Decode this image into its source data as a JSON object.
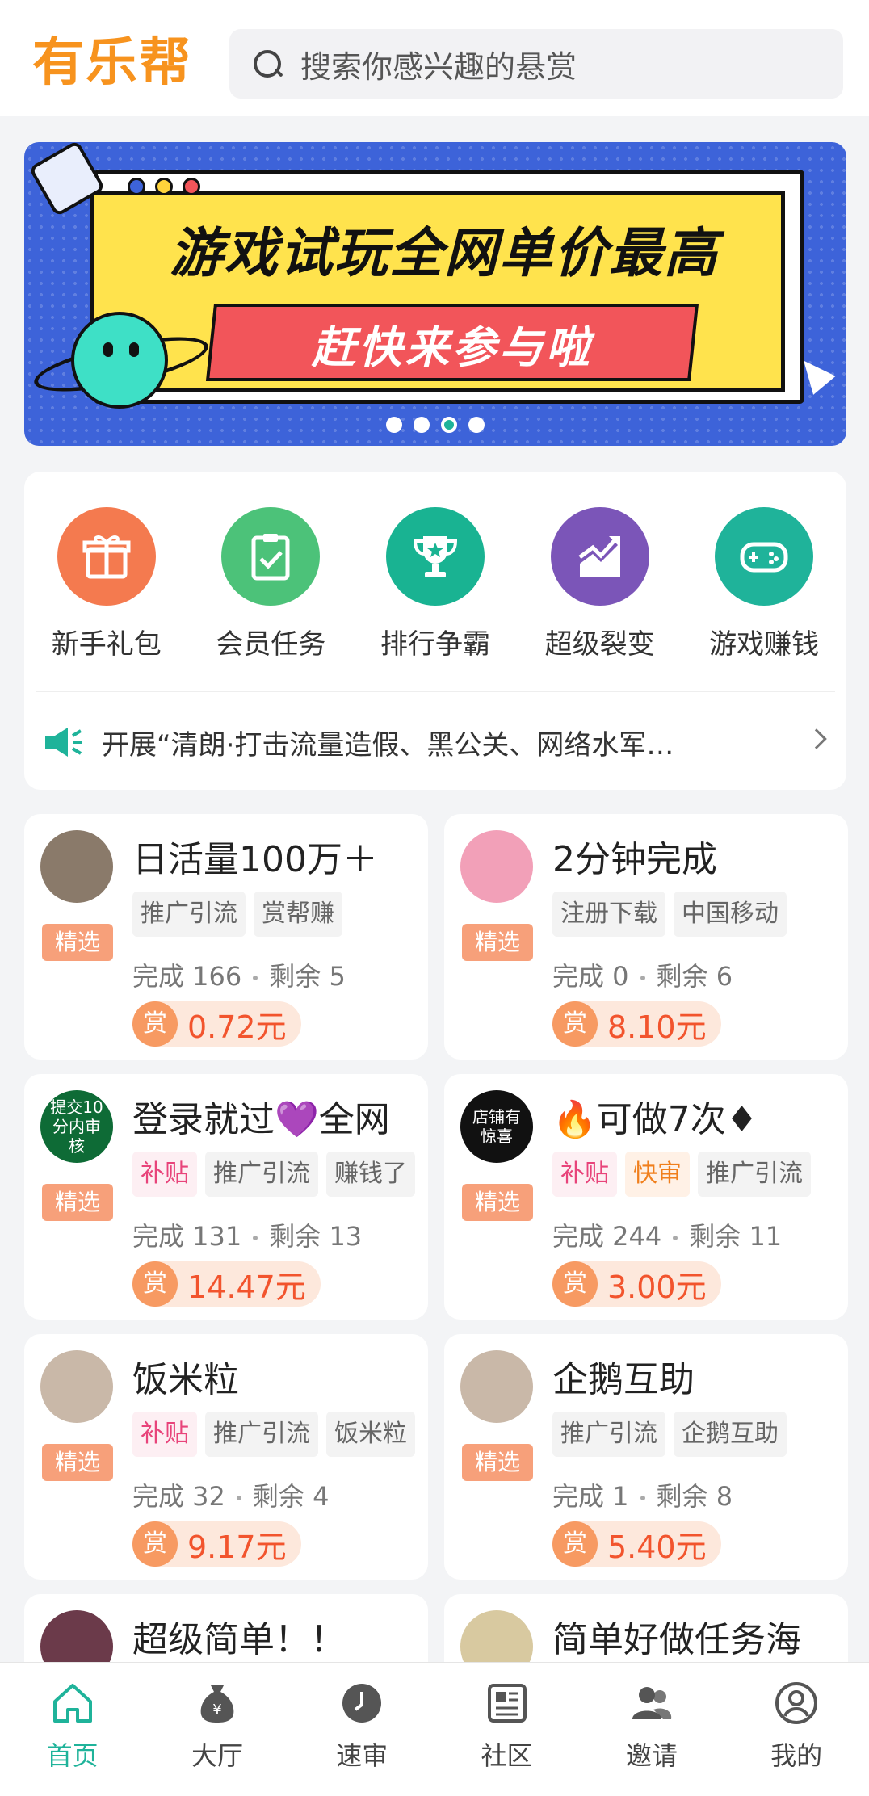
{
  "header": {
    "app_title": "有乐帮",
    "search_placeholder": "搜索你感兴趣的悬赏"
  },
  "banner": {
    "headline": "游戏试玩全网单价最高",
    "subline": "赶快来参与啦",
    "slides_count": 4,
    "active_slide": 3
  },
  "quick_menu": [
    {
      "label": "新手礼包",
      "icon": "gift-icon",
      "color": "#f47a4f"
    },
    {
      "label": "会员任务",
      "icon": "clipboard-check-icon",
      "color": "#4cc279"
    },
    {
      "label": "排行争霸",
      "icon": "trophy-icon",
      "color": "#19b392"
    },
    {
      "label": "超级裂变",
      "icon": "trend-chart-icon",
      "color": "#7b55b8"
    },
    {
      "label": "游戏赚钱",
      "icon": "gamepad-icon",
      "color": "#1fb39a"
    }
  ],
  "notice": {
    "icon": "megaphone-icon",
    "text": "开展“清朗·打击流量造假、黑公关、网络水军…"
  },
  "tasks": [
    {
      "title": "日活量100万＋",
      "badge": "精选",
      "tags": [
        {
          "text": "推广引流",
          "kind": "normal"
        },
        {
          "text": "赏帮赚",
          "kind": "normal"
        }
      ],
      "completed_label": "完成 166",
      "remaining_label": "剩余 5",
      "reward_icon": "赏",
      "reward": "0.72元",
      "avatar_color": "#8a7a6a"
    },
    {
      "title": "2分钟完成",
      "badge": "精选",
      "tags": [
        {
          "text": "注册下载",
          "kind": "normal"
        },
        {
          "text": "中国移动",
          "kind": "normal"
        }
      ],
      "completed_label": "完成 0",
      "remaining_label": "剩余 6",
      "reward_icon": "赏",
      "reward": "8.10元",
      "avatar_color": "#f2a0b8"
    },
    {
      "title": "登录就过💜全网",
      "badge": "精选",
      "tags": [
        {
          "text": "补贴",
          "kind": "sub"
        },
        {
          "text": "推广引流",
          "kind": "normal"
        },
        {
          "text": "赚钱了",
          "kind": "normal"
        }
      ],
      "completed_label": "完成 131",
      "remaining_label": "剩余 13",
      "reward_icon": "赏",
      "reward": "14.47元",
      "avatar_color": "#0e6b36",
      "avatar_text": "提交10分内审核"
    },
    {
      "title": "🔥可做7次♦",
      "badge": "精选",
      "tags": [
        {
          "text": "补贴",
          "kind": "sub"
        },
        {
          "text": "快审",
          "kind": "fast"
        },
        {
          "text": "推广引流",
          "kind": "normal"
        }
      ],
      "completed_label": "完成 244",
      "remaining_label": "剩余 11",
      "reward_icon": "赏",
      "reward": "3.00元",
      "avatar_color": "#111111",
      "avatar_text": "店铺有惊喜"
    },
    {
      "title": "饭米粒",
      "badge": "精选",
      "tags": [
        {
          "text": "补贴",
          "kind": "sub"
        },
        {
          "text": "推广引流",
          "kind": "normal"
        },
        {
          "text": "饭米粒",
          "kind": "normal"
        }
      ],
      "completed_label": "完成 32",
      "remaining_label": "剩余 4",
      "reward_icon": "赏",
      "reward": "9.17元",
      "avatar_color": "#c9b8a8"
    },
    {
      "title": "企鹅互助",
      "badge": "精选",
      "tags": [
        {
          "text": "推广引流",
          "kind": "normal"
        },
        {
          "text": "企鹅互助",
          "kind": "normal"
        }
      ],
      "completed_label": "完成 1",
      "remaining_label": "剩余 8",
      "reward_icon": "赏",
      "reward": "5.40元",
      "avatar_color": "#c9b8a8"
    },
    {
      "title": "超级简单！！",
      "badge": "",
      "tags": [],
      "completed_label": "",
      "remaining_label": "",
      "reward_icon": "",
      "reward": "",
      "avatar_color": "#6b3a4a"
    },
    {
      "title": "简单好做任务海",
      "badge": "",
      "tags": [],
      "completed_label": "",
      "remaining_label": "",
      "reward_icon": "",
      "reward": "",
      "avatar_color": "#d8c9a0"
    }
  ],
  "bottom_nav": [
    {
      "label": "首页",
      "icon": "home-icon",
      "active": true
    },
    {
      "label": "大厅",
      "icon": "money-bag-icon",
      "active": false
    },
    {
      "label": "速审",
      "icon": "clock-icon",
      "active": false
    },
    {
      "label": "社区",
      "icon": "news-icon",
      "active": false
    },
    {
      "label": "邀请",
      "icon": "users-icon",
      "active": false
    },
    {
      "label": "我的",
      "icon": "profile-icon",
      "active": false
    }
  ],
  "colors": {
    "brand_orange": "#f7931e",
    "accent_green": "#1fb39a",
    "reward_red": "#f2542d"
  }
}
